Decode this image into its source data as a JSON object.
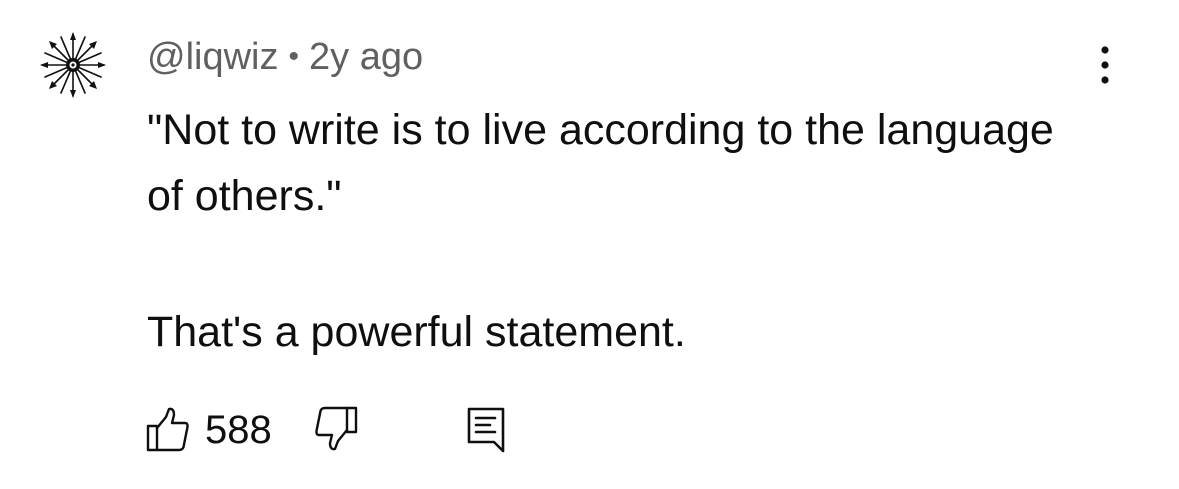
{
  "comment": {
    "author": "@liqwiz",
    "separator": "•",
    "timestamp": "2y ago",
    "paragraphs": [
      "\"Not to write is to live according to the language of others.\"",
      "That's a powerful statement."
    ],
    "like_count": "588"
  },
  "icons": {
    "avatar": "compass-star-avatar",
    "more": "more-vertical-icon",
    "like": "thumbs-up-icon",
    "dislike": "thumbs-down-icon",
    "reply": "reply-comment-icon"
  },
  "colors": {
    "text_primary": "#0f0f0f",
    "text_secondary": "#606060",
    "background": "#ffffff"
  }
}
